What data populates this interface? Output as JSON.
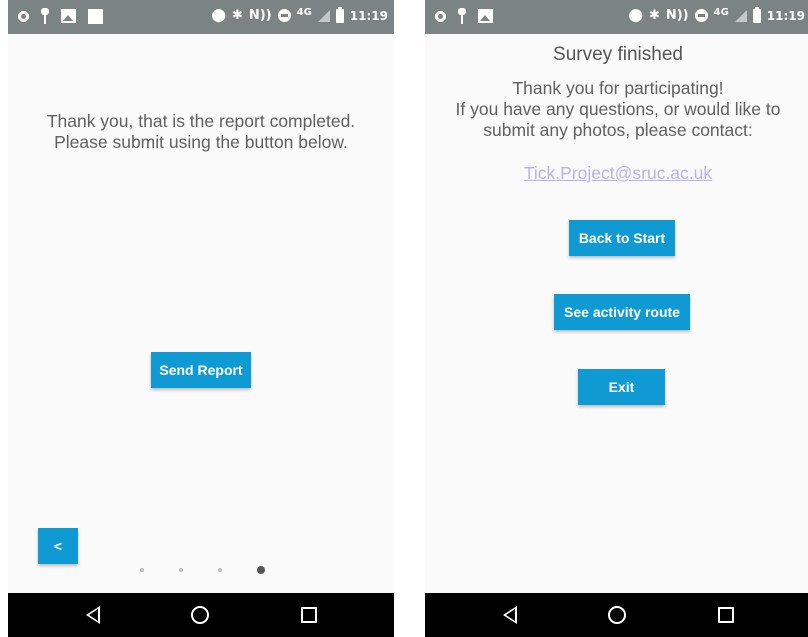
{
  "status_bar": {
    "time": "11:19",
    "network": "4G",
    "left_icons": [
      "ring-icon",
      "key-icon",
      "image-icon",
      "square-icon"
    ],
    "right_icons": [
      "location-icon",
      "bluetooth-icon",
      "nfc-icon",
      "dnd-icon",
      "signal-icon",
      "battery-icon"
    ]
  },
  "report_screen": {
    "message": "Thank you, that is the report completed. Please submit using the button below.",
    "send_button": "Send Report",
    "back_button": "<",
    "pager": {
      "total": 4,
      "current": 4
    }
  },
  "finished_screen": {
    "title": "Survey finished",
    "thank_you": "Thank you for participating!",
    "contact_text": "If you have any questions, or would like to submit any photos, please contact:",
    "email": "Tick.Project@sruc.ac.uk",
    "back_to_start_button": "Back to Start",
    "activity_route_button": "See activity route",
    "exit_button": "Exit"
  },
  "nav_bar": {
    "icons": [
      "back-icon",
      "home-icon",
      "recents-icon"
    ]
  },
  "colors": {
    "accent": "#0f9ad4",
    "status_bar": "#7c8385",
    "link": "#b9b2ef",
    "text": "#606060"
  }
}
